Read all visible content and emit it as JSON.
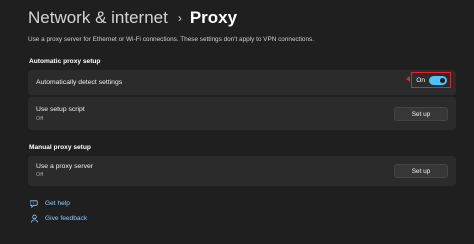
{
  "header": {
    "parent": "Network & internet",
    "separator": "›",
    "current": "Proxy"
  },
  "description": "Use a proxy server for Ethernet or Wi-Fi connections. These settings don't apply to VPN connections.",
  "automatic": {
    "title": "Automatic proxy setup",
    "detect": {
      "label": "Automatically detect settings",
      "state": "On",
      "enabled": true
    },
    "script": {
      "label": "Use setup script",
      "status": "Off",
      "button": "Set up"
    }
  },
  "manual": {
    "title": "Manual proxy setup",
    "server": {
      "label": "Use a proxy server",
      "status": "Off",
      "button": "Set up"
    }
  },
  "links": {
    "help": "Get help",
    "feedback": "Give feedback"
  },
  "colors": {
    "background": "#1f1f1f",
    "card": "#2b2b2b",
    "accent": "#4cc2ff",
    "highlight": "#e0262a"
  },
  "icons": {
    "help": "help-icon",
    "feedback": "feedback-icon"
  }
}
